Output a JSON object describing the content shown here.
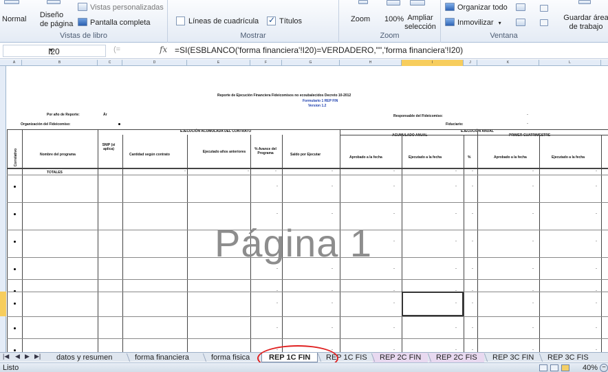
{
  "ribbon": {
    "views_group": {
      "label": "Vistas de libro",
      "normal": "Normal",
      "page_layout": "Diseño\nde página",
      "page_layout_l1": "Diseño",
      "page_layout_l2": "de página",
      "custom_views": "Vistas personalizadas",
      "full_screen": "Pantalla completa"
    },
    "show_group": {
      "label": "Mostrar",
      "gridlines": "Líneas de cuadrícula",
      "gridlines_checked": false,
      "headings": "Títulos",
      "headings_checked": true
    },
    "zoom_group": {
      "label": "Zoom",
      "zoom": "Zoom",
      "hundred": "100%",
      "zoom_sel_l1": "Ampliar",
      "zoom_sel_l2": "selección"
    },
    "window_group": {
      "label": "Ventana",
      "arrange_all": "Organizar todo",
      "freeze": "Inmovilizar",
      "save_l1": "Guardar área",
      "save_l2": "de trabajo"
    }
  },
  "formula_bar": {
    "cell_ref": "I20",
    "fx": "fx",
    "formula": "=SI(ESBLANCO('forma financiera'!I20)=VERDADERO,\"\",'forma financiera'!I20)"
  },
  "sheet": {
    "columns": [
      "A",
      "B",
      "C",
      "D",
      "E",
      "F",
      "G",
      "H",
      "I",
      "J",
      "K",
      "L"
    ],
    "title": "Reporte de Ejecución Financiera Fideicomisos no ecoubalecidos Decreto 10-2012",
    "form_code": "Formulario 1 REP FIN",
    "version": "Version 1.2",
    "period_label": "Por año de Reporte:",
    "period_value": "Ár",
    "org_label": "Organización del Fideicomiso:",
    "responsible_label": "Responsable del Fideicomiso:",
    "trustee_label": "Fiduciario:",
    "section_contract": "EJECUCIÓN ACUMULADA DEL CONTRATO",
    "section_annual_acc": "ACUMULADO ANUAL",
    "section_annual_exec": "EJECUCIÓN ANUAL",
    "section_q1": "PRIMER CUATRIMESTRE",
    "headers": {
      "correlativo": "Correlativo",
      "program_name": "Nombre del programa",
      "snip": "SNIP (si aplica)",
      "amount": "Cantidad según contrato",
      "prev_exec": "Ejecutado años anteriores",
      "pct_progress": "% Avance del Programa",
      "balance": "Saldo por Ejecutar",
      "approved": "Aprobado a la fecha",
      "executed": "Ejecutado a la fecha",
      "pct": "%",
      "q1_approved": "Aprobado a la fecha",
      "q1_executed": "Ejecutado a la fecha"
    },
    "totals_label": "TOTALES",
    "dash": "-",
    "watermark": "Página 1"
  },
  "tabs": [
    {
      "label": "datos y resumen",
      "active": false
    },
    {
      "label": "forma financiera",
      "active": false
    },
    {
      "label": "forma fisica",
      "active": false
    },
    {
      "label": "REP 1C FIN",
      "active": true
    },
    {
      "label": "REP 1C FIS",
      "active": false
    },
    {
      "label": "REP 2C FIN",
      "active": false
    },
    {
      "label": "REP 2C FIS",
      "active": false
    },
    {
      "label": "REP 3C FIN",
      "active": false
    },
    {
      "label": "REP 3C FIS",
      "active": false
    }
  ],
  "status_bar": {
    "ready": "Listo",
    "zoom": "40%"
  },
  "colors": {
    "ribbon_bg": "#e4ebf5",
    "highlight": "#e02020",
    "selected_row": "#f7cd5d"
  }
}
